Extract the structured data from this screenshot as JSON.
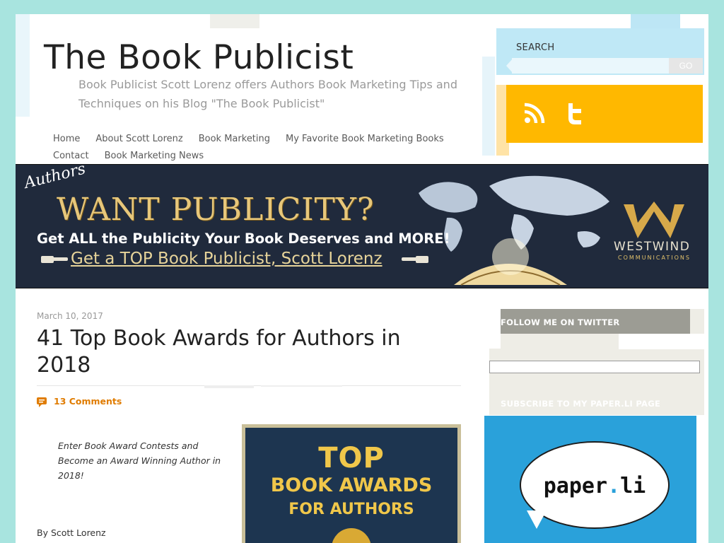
{
  "site": {
    "title": "The Book Publicist",
    "tagline": "Book Publicist Scott Lorenz offers Authors Book Marketing Tips and Techniques on his Blog \"The Book Publicist\""
  },
  "nav": {
    "items": [
      "Home",
      "About Scott Lorenz",
      "Book Marketing",
      "My Favorite Book Marketing Books",
      "Contact",
      "Book Marketing News"
    ]
  },
  "search": {
    "label": "SEARCH",
    "value": "",
    "go_label": "GO"
  },
  "social": {
    "icons": [
      "rss-icon",
      "twitter-icon"
    ],
    "color": "#ffb800"
  },
  "banner": {
    "authors": "Authors",
    "headline": "WANT PUBLICITY?",
    "subheadline": "Get ALL the Publicity Your Book Deserves and MORE!",
    "cta": "Get a TOP Book Publicist, Scott Lorenz",
    "logo_name": "WESTWIND",
    "logo_sub": "COMMUNICATIONS"
  },
  "post": {
    "date": "March 10, 2017",
    "title": "41 Top Book Awards for Authors in 2018",
    "comments": "13 Comments",
    "intro": "Enter Book Award Contests and Become an Award Winning Author in 2018!",
    "byline": "By Scott Lorenz",
    "image": {
      "line1": "TOP",
      "line2": "BOOK AWARDS",
      "line3": "FOR AUTHORS"
    }
  },
  "sidebar": {
    "follow_label": "FOLLOW ME ON TWITTER",
    "paper_label": "SUBSCRIBE TO MY PAPER.LI PAGE",
    "paper_logo_a": "paper",
    "paper_logo_dot": ".",
    "paper_logo_b": "li"
  },
  "colors": {
    "background": "#a8e4df",
    "accent_orange": "#e07c00",
    "social_yellow": "#ffb800",
    "search_blue": "#bfe8f6",
    "banner_navy": "#202a3c"
  }
}
